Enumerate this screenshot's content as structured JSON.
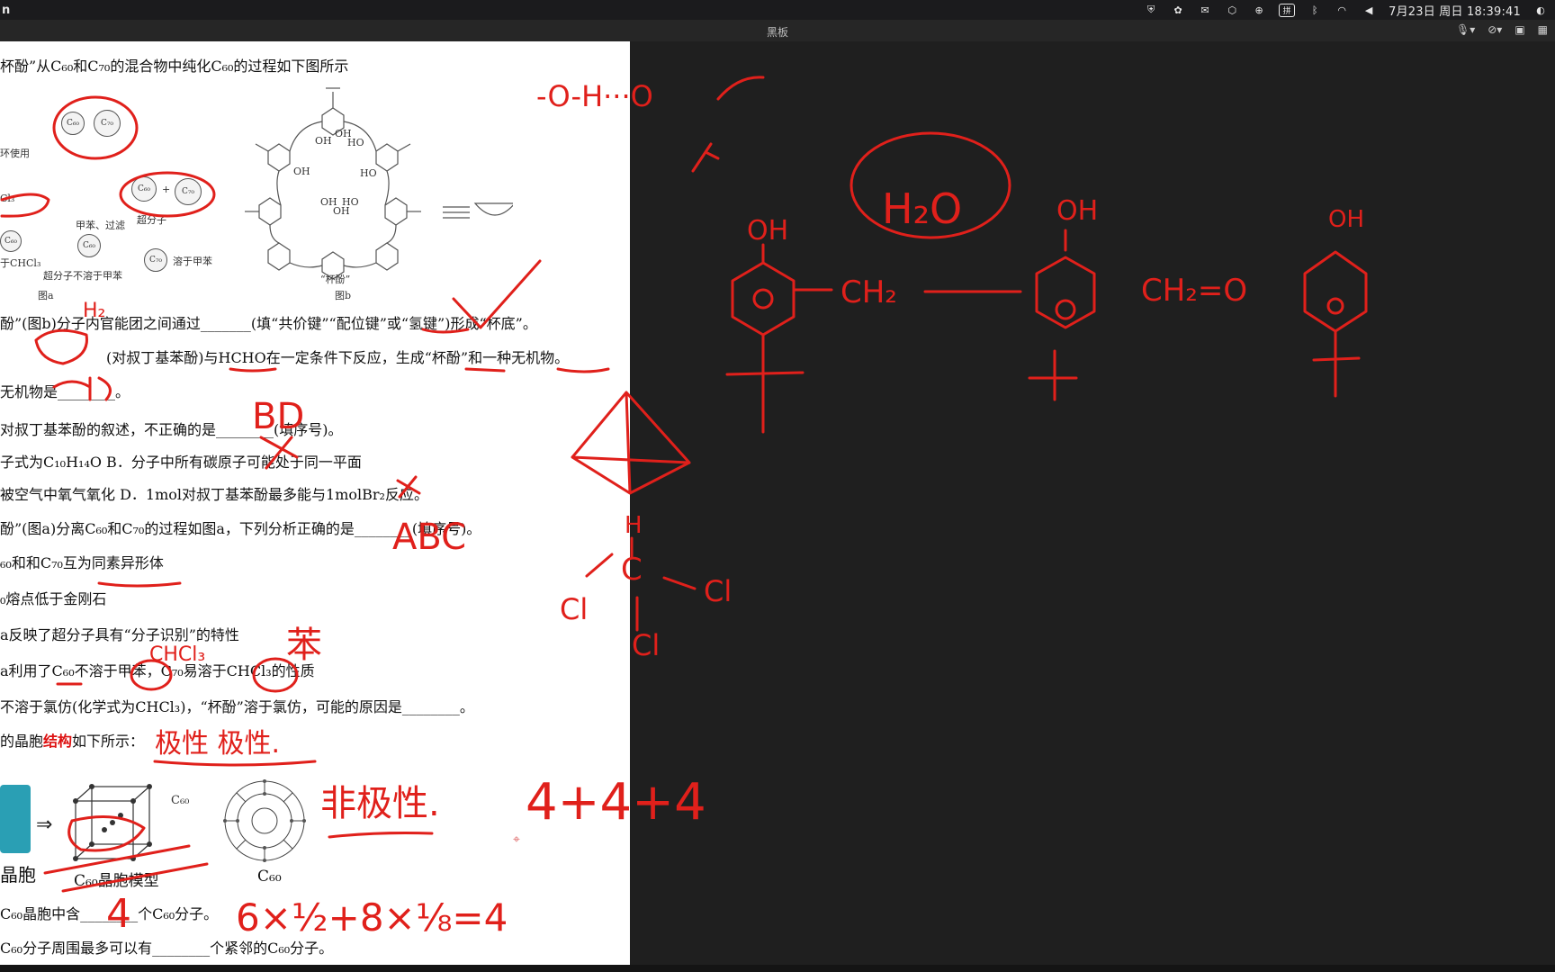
{
  "menubar": {
    "app_label": "n",
    "clock": "7月23日 周日  18:39:41",
    "icons": [
      "shield-icon",
      "flower-icon",
      "mail-icon",
      "hexagon-icon",
      "accessibility-icon",
      "pinyin-input-icon",
      "bluetooth-icon",
      "wifi-icon",
      "volume-icon"
    ],
    "pinyin_label": "拼"
  },
  "window": {
    "title": "黑板",
    "tools": [
      "mic-icon",
      "mic-off-icon",
      "camera-icon",
      "grid-icon"
    ]
  },
  "document": {
    "lines": [
      "杯酚”从C₆₀和C₇₀的混合物中纯化C₆₀的过程如下图所示",
      "酚”(图b)分子内官能团之间通过_______(填“共价键”“配位键”或“氢键”)形成“杯底”。",
      "(对叔丁基苯酚)与HCHO在一定条件下反应，生成“杯酚”和一种无机物。",
      "无机物是________。",
      "对叔丁基苯酚的叙述，不正确的是________(填序号)。",
      "子式为C₁₀H₁₄O B．分子中所有碳原子可能处于同一平面",
      "被空气中氧气氧化            D．1mol对叔丁基苯酚最多能与1molBr₂反应。",
      "酚”(图a)分离C₆₀和C₇₀的过程如图a，下列分析正确的是________(填序号)。",
      "₆₀和和C₇₀互为同素异形体",
      "₀熔点低于金刚石",
      "a反映了超分子具有“分子识别”的特性",
      "a利用了C₆₀不溶于甲苯，C₇₀易溶于CHCl₃的性质",
      "不溶于氯仿(化学式为CHCl₃)，“杯酚”溶于氯仿，可能的原因是________。",
      "C₆₀晶胞中含________个C₆₀分子。",
      "C₆₀分子周围最多可以有________个紧邻的C₆₀分子。"
    ],
    "crystal_line_prefix": "的晶胞",
    "crystal_line_red": "结构",
    "crystal_line_suffix": "如下所示：",
    "figure_a": {
      "labels": [
        "环使用",
        "Cl₃",
        "甲苯、过滤",
        "超分子",
        "于CHCl₃",
        "超分子不溶于甲苯",
        "溶于甲苯",
        "图a"
      ],
      "molecules": [
        "C₆₀",
        "C₇₀",
        "C₆₀",
        "C₇₀",
        "C₆₀",
        "C₆₀",
        "C₇₀"
      ],
      "plus": "+"
    },
    "figure_b": {
      "labels": [
        "OH",
        "OH",
        "HO",
        "OH",
        "HO",
        "OH",
        "HO",
        "OH",
        "“杯酚”",
        "图b"
      ],
      "equiv": "≡"
    },
    "crystal_figure": {
      "labels": [
        "晶胞",
        "C₆₀晶胞模型",
        "C₆₀",
        "C₆₀"
      ]
    }
  },
  "annotations": {
    "answer_bd": "BD",
    "answer_abc": "ABC",
    "answer_4": "4",
    "h2o_label": "H₂O",
    "chcl3_label": "CHCl₃",
    "ben_label": "苯",
    "polar_label": "极性  极性.",
    "nonpolar_label": "非极性.",
    "sum_label": "4+4+4",
    "calc_label": "6×½+8×⅛=4",
    "ch2_label": "CH₂",
    "ch2o_label": "CH₂=O",
    "oh_labels": [
      "OH",
      "OH",
      "OH"
    ],
    "struct_text": "-O-H···O",
    "cl_labels": [
      "Cl",
      "Cl",
      "Cl"
    ],
    "c_label": "C",
    "h_label": "H",
    "h2_label": "H₂"
  },
  "colors": {
    "ink": "#e0201b",
    "board": "#1f1f1f",
    "highlight_red": "#d11111"
  }
}
